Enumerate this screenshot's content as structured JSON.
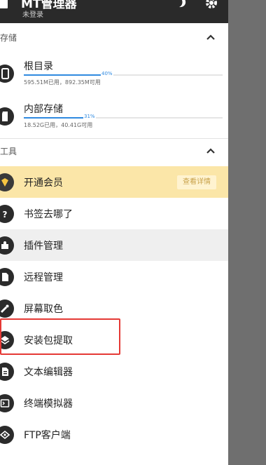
{
  "header": {
    "title": "MT管理器",
    "subtitle": "未登录",
    "title_color": "#ffffff",
    "background": "#2a2a2a"
  },
  "sections": {
    "storage_label": "存储",
    "tools_label": "工具"
  },
  "storage": [
    {
      "name": "根目录",
      "percent_label": "40%",
      "percent": 40,
      "usage": "595.51M已用，892.35M可用",
      "icon": "phone-icon"
    },
    {
      "name": "内部存储",
      "percent_label": "31%",
      "percent": 31,
      "usage": "18.52G已用，40.41G可用",
      "icon": "sdcard-icon"
    }
  ],
  "tools": [
    {
      "label": "开通会员",
      "icon": "vip-gem-icon",
      "action_label": "查看详情"
    },
    {
      "label": "书签去哪了",
      "icon": "question-icon"
    },
    {
      "label": "插件管理",
      "icon": "puzzle-icon"
    },
    {
      "label": "远程管理",
      "icon": "file-icon"
    },
    {
      "label": "屏幕取色",
      "icon": "eyedropper-icon"
    },
    {
      "label": "安装包提取",
      "icon": "layers-icon"
    },
    {
      "label": "文本编辑器",
      "icon": "text-file-icon"
    },
    {
      "label": "终端模拟器",
      "icon": "terminal-icon"
    },
    {
      "label": "FTP客户端",
      "icon": "ftp-icon"
    }
  ],
  "colors": {
    "accent": "#2f8ae0",
    "vip_highlight": "#fbe6a8",
    "red_outline": "#e53935"
  }
}
